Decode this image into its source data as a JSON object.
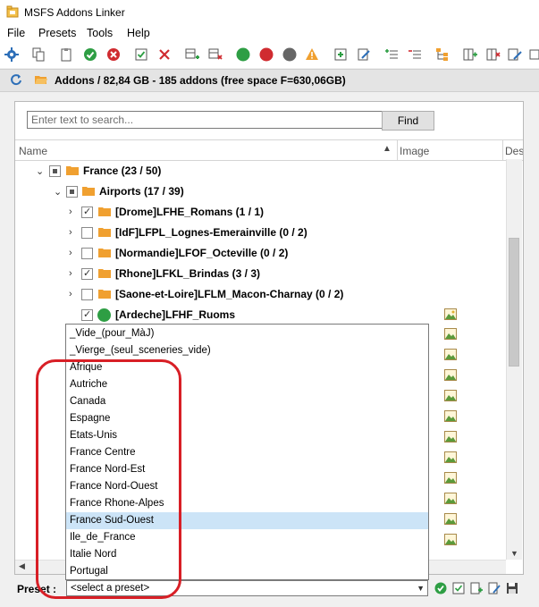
{
  "window": {
    "title": "MSFS Addons Linker"
  },
  "menu": {
    "file": "File",
    "presets": "Presets",
    "tools": "Tools",
    "help": "Help"
  },
  "toolbar_icons": [
    "gear-icon",
    "copy-icon",
    "paste-icon",
    "check-icon",
    "cancel-icon",
    "checkbox-icon",
    "close-icon",
    "add-table-icon",
    "remove-table-icon",
    "green-circle-icon",
    "red-circle-icon",
    "gray-circle-icon",
    "warning-icon",
    "add-list-icon",
    "indent-add-icon",
    "indent-remove-icon",
    "tree-icon",
    "add-col-icon",
    "remove-col-icon",
    "edit-col-icon",
    "more-icon"
  ],
  "path": {
    "text": "Addons / 82,84 GB - 185 addons (free space F=630,06GB)"
  },
  "search": {
    "placeholder": "Enter text to search...",
    "find_label": "Find"
  },
  "grid": {
    "col_name": "Name",
    "col_image": "Image",
    "col_desc": "Des"
  },
  "tree": {
    "france": "France (23 / 50)",
    "airports": "Airports (17 / 39)",
    "items": [
      "[Drome]LFHE_Romans (1 / 1)",
      "[IdF]LFPL_Lognes-Emerainville (0 / 2)",
      "[Normandie]LFOF_Octeville (0 / 2)",
      "[Rhone]LFKL_Brindas (3 / 3)",
      "[Saone-et-Loire]LFLM_Macon-Charnay (0 / 2)",
      "[Ardeche]LFHF_Ruoms"
    ]
  },
  "dropdown": {
    "options": [
      "_Vide_(pour_MàJ)",
      "_Vierge_(seul_sceneries_vide)",
      "Afrique",
      "Autriche",
      "Canada",
      "Espagne",
      "Etats-Unis",
      "France Centre",
      "France Nord-Est",
      "France Nord-Ouest",
      "France Rhone-Alpes",
      "France Sud-Ouest",
      "Ile_de_France",
      "Italie Nord",
      "Portugal"
    ],
    "highlighted": "France Sud-Ouest"
  },
  "preset": {
    "label": "Preset :",
    "value": "<select a preset>"
  },
  "colors": {
    "folder": "#f0a030",
    "green": "#2e9e44",
    "red": "#d81f26",
    "highlight": "#cce4f7",
    "annotation": "#d81f26"
  }
}
